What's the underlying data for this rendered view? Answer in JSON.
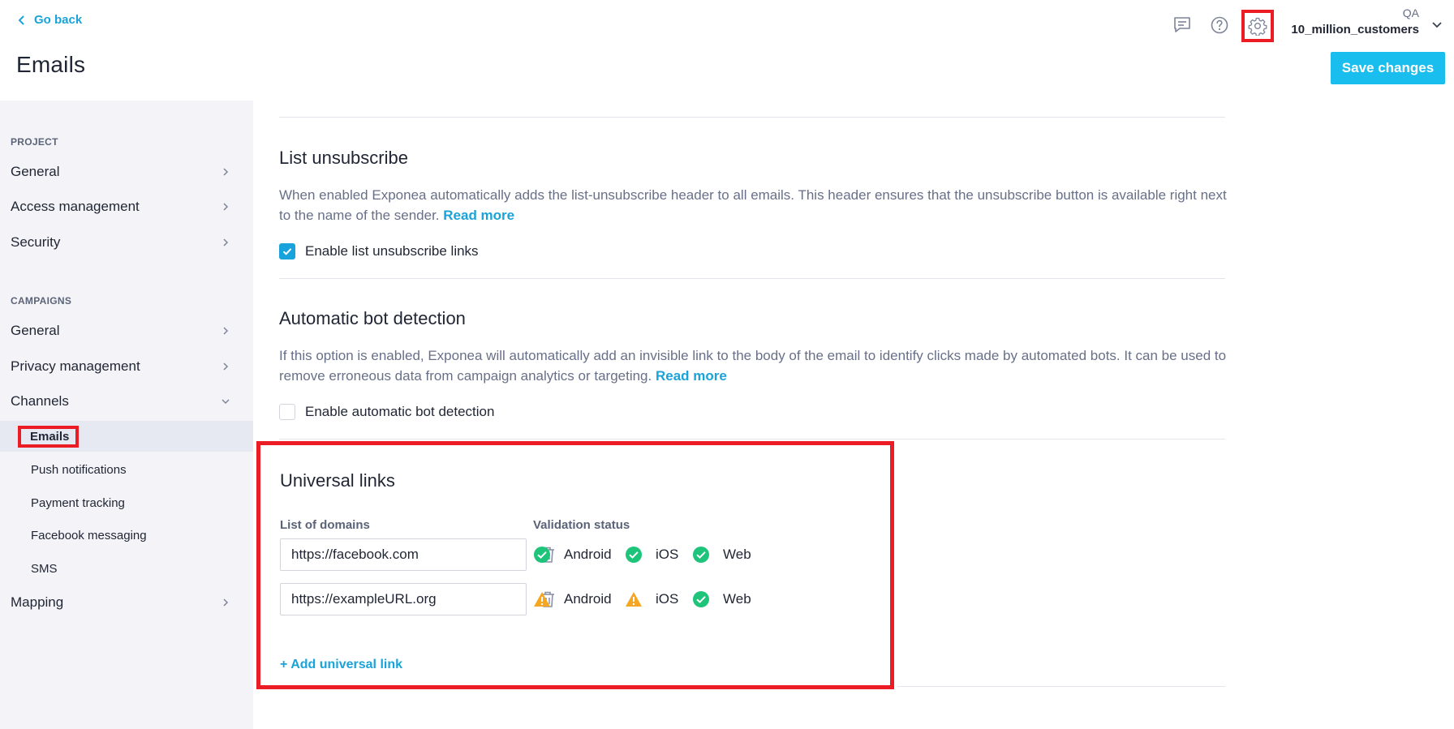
{
  "header": {
    "go_back": "Go back",
    "title": "Emails",
    "account_role": "QA",
    "account_name": "10_million_customers",
    "save_label": "Save changes",
    "icons": [
      "chat-icon",
      "help-icon",
      "gear-icon",
      "chevron-down-icon"
    ]
  },
  "sidebar": {
    "project_heading": "PROJECT",
    "project_items": [
      {
        "label": "General"
      },
      {
        "label": "Access management"
      },
      {
        "label": "Security"
      }
    ],
    "campaigns_heading": "CAMPAIGNS",
    "campaign_items": [
      {
        "label": "General"
      },
      {
        "label": "Privacy management"
      },
      {
        "label": "Channels"
      }
    ],
    "channel_subitems": [
      {
        "label": "Emails",
        "active": true
      },
      {
        "label": "Push notifications"
      },
      {
        "label": "Payment tracking"
      },
      {
        "label": "Facebook messaging"
      },
      {
        "label": "SMS"
      }
    ],
    "mapping": {
      "label": "Mapping"
    }
  },
  "list_unsubscribe": {
    "title": "List unsubscribe",
    "description": "When enabled Exponea automatically adds the list-unsubscribe header to all emails. This header ensures that the unsubscribe button is available right next to the name of the sender.",
    "read_more": "Read more",
    "checkbox_label": "Enable list unsubscribe links",
    "checked": true
  },
  "bot_detection": {
    "title": "Automatic bot detection",
    "description": "If this option is enabled, Exponea will automatically add an invisible link to the body of the email to identify clicks made by automated bots. It can be used to remove erroneous data from campaign analytics or targeting.",
    "read_more": "Read more",
    "checkbox_label": "Enable automatic bot detection",
    "checked": false
  },
  "universal_links": {
    "title": "Universal links",
    "domains_label": "List of domains",
    "validation_label": "Validation status",
    "rows": [
      {
        "domain": "https://facebook.com",
        "android": {
          "label": "Android",
          "status": "valid"
        },
        "ios": {
          "label": "iOS",
          "status": "valid"
        },
        "web": {
          "label": "Web",
          "status": "valid"
        }
      },
      {
        "domain": "https://exampleURL.org",
        "android": {
          "label": "Android",
          "status": "warning"
        },
        "ios": {
          "label": "iOS",
          "status": "warning"
        },
        "web": {
          "label": "Web",
          "status": "valid"
        }
      }
    ],
    "add_link": "+ Add universal link"
  },
  "colors": {
    "accent": "#19bdee",
    "link": "#1aa3d9",
    "valid": "#1dc47a",
    "warning": "#f5a623",
    "highlight": "#ec1c24"
  }
}
